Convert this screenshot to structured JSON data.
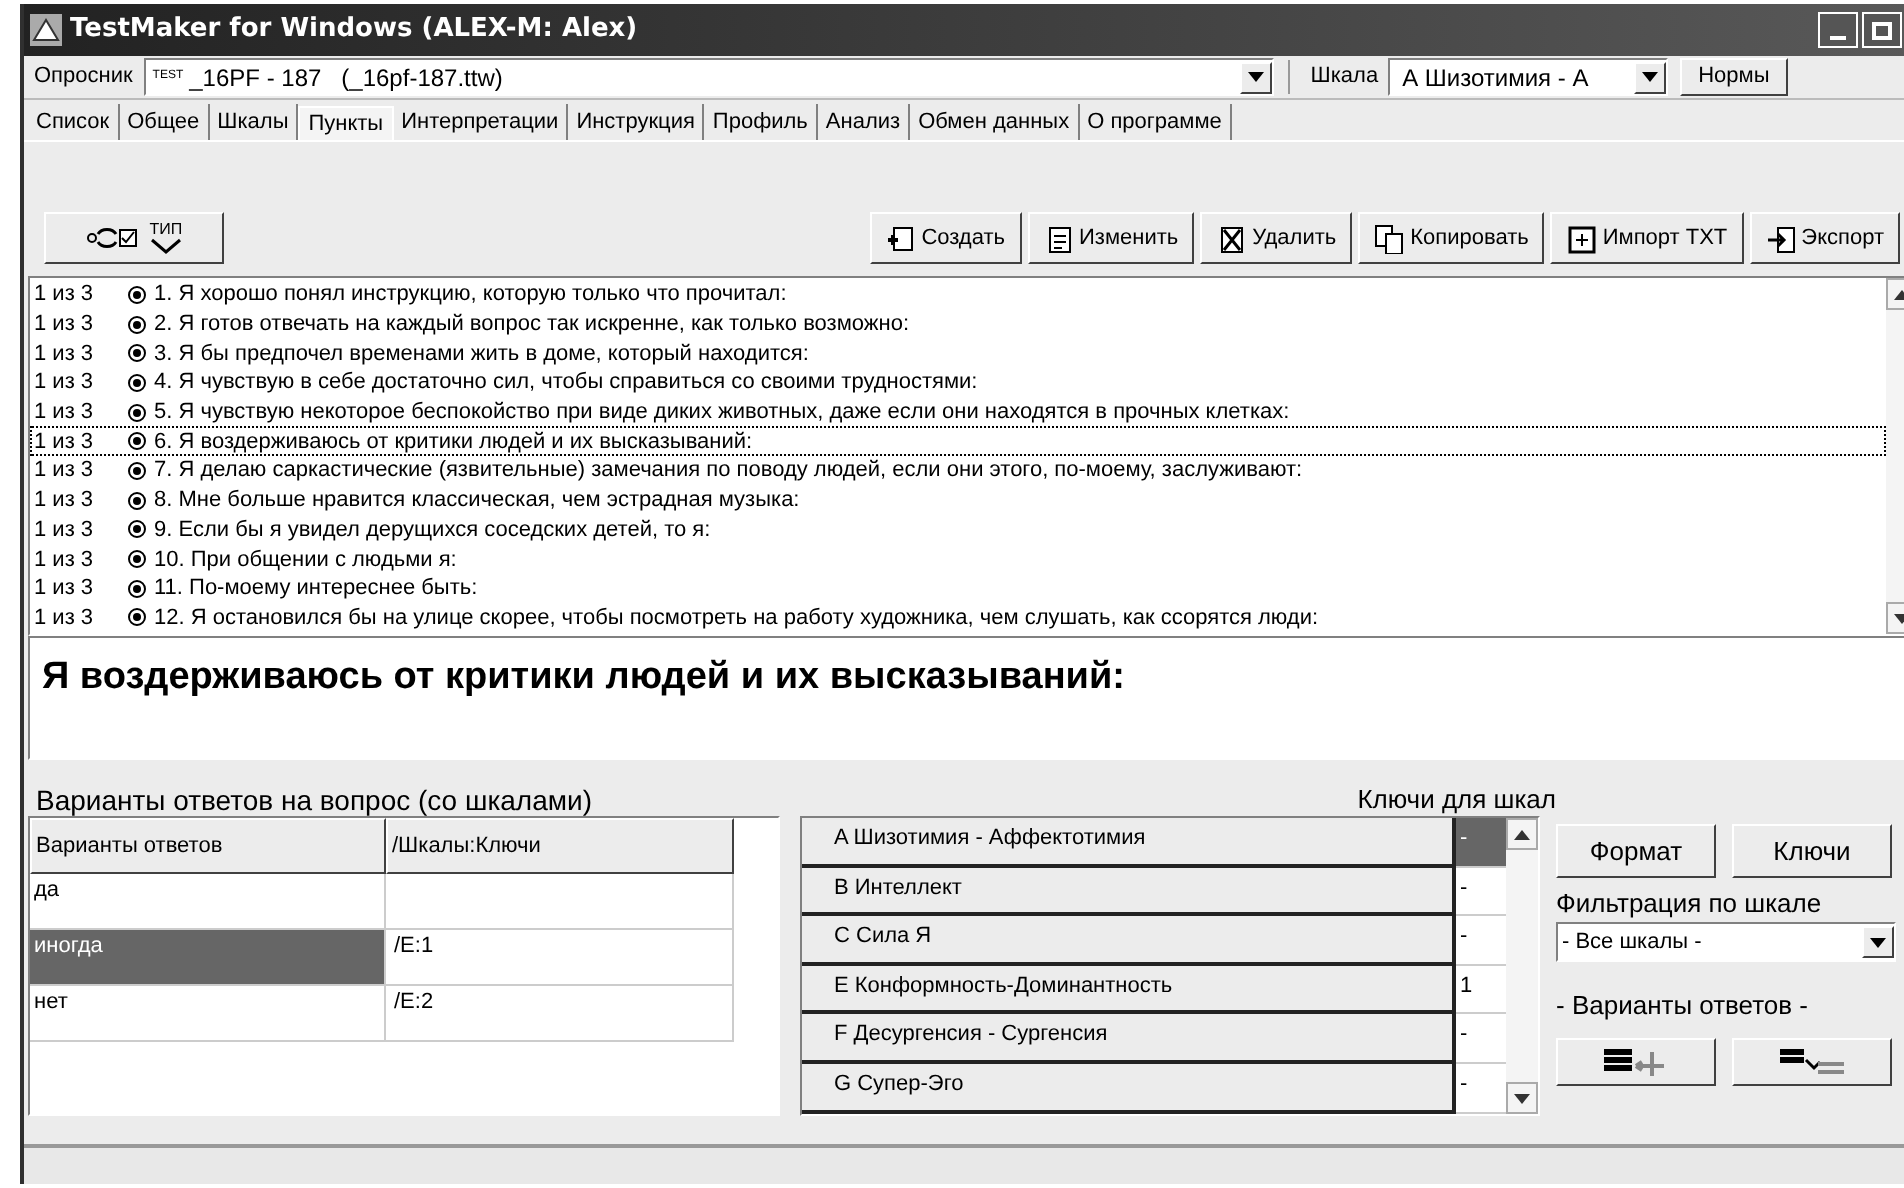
{
  "window": {
    "title": "TestMaker for Windows (ALEX-M: Alex)"
  },
  "header": {
    "questionnaire_label": "Опросник",
    "questionnaire_tag": "TEST",
    "questionnaire_value": "_16PF - 187   (_16pf-187.ttw)",
    "scale_label": "Шкала",
    "scale_value": "А Шизотимия - А",
    "norms_button": "Нормы"
  },
  "tabs": [
    {
      "label": "Список",
      "selected": false
    },
    {
      "label": "Общее",
      "selected": false
    },
    {
      "label": "Шкалы",
      "selected": false
    },
    {
      "label": "Пункты",
      "selected": true
    },
    {
      "label": "Интерпретации",
      "selected": false
    },
    {
      "label": "Инструкция",
      "selected": false
    },
    {
      "label": "Профиль",
      "selected": false
    },
    {
      "label": "Анализ",
      "selected": false
    },
    {
      "label": "Обмен данных",
      "selected": false
    },
    {
      "label": "О программе",
      "selected": false
    }
  ],
  "toolbar": {
    "type_label": "ТИП",
    "buttons": [
      {
        "label": "Создать",
        "kind": "create"
      },
      {
        "label": "Изменить",
        "kind": "edit"
      },
      {
        "label": "Удалить",
        "kind": "delete"
      },
      {
        "label": "Копировать",
        "kind": "copy"
      },
      {
        "label": "Импорт TXT",
        "kind": "import"
      },
      {
        "label": "Экспорт",
        "kind": "export"
      }
    ]
  },
  "items": [
    {
      "count": "1 из 3",
      "text": "1. Я хорошо понял инструкцию, которую только что прочитал:",
      "selected": false
    },
    {
      "count": "1 из 3",
      "text": "2. Я готов отвечать на каждый вопрос так искренне, как только возможно:",
      "selected": false
    },
    {
      "count": "1 из 3",
      "text": "3. Я бы предпочел временами жить в доме, который находится:",
      "selected": false
    },
    {
      "count": "1 из 3",
      "text": "4. Я чувствую в себе достаточно сил, чтобы справиться со своими трудностями:",
      "selected": false
    },
    {
      "count": "1 из 3",
      "text": "5. Я чувствую некоторое беспокойство при виде диких животных, даже если они находятся в прочных клетках:",
      "selected": false
    },
    {
      "count": "1 из 3",
      "text": "6. Я воздерживаюсь от критики людей и их высказываний:",
      "selected": true
    },
    {
      "count": "1 из 3",
      "text": "7. Я делаю саркастические (язвительные) замечания по поводу людей, если они этого, по-моему, заслуживают:",
      "selected": false
    },
    {
      "count": "1 из 3",
      "text": "8. Мне больше нравится классическая, чем эстрадная музыка:",
      "selected": false
    },
    {
      "count": "1 из 3",
      "text": "9. Если бы я увидел дерущихся соседских детей, то я:",
      "selected": false
    },
    {
      "count": "1 из 3",
      "text": "10. При общении с людьми я:",
      "selected": false
    },
    {
      "count": "1 из 3",
      "text": "11. По-моему интереснее быть:",
      "selected": false
    },
    {
      "count": "1 из 3",
      "text": "12. Я остановился бы на улице скорее, чтобы посмотреть на работу художника, чем слушать, как ссорятся люди:",
      "selected": false
    }
  ],
  "question_text": "Я воздерживаюсь от критики людей и их высказываний:",
  "answers": {
    "title": "Варианты ответов на вопрос (со шкалами)",
    "columns": [
      "Варианты ответов",
      "/Шкалы:Ключи"
    ],
    "rows": [
      {
        "answer": "да",
        "keys": "",
        "selected": false
      },
      {
        "answer": "иногда",
        "keys": "/E:1",
        "selected": true
      },
      {
        "answer": "нет",
        "keys": "/E:2",
        "selected": false
      }
    ]
  },
  "keys": {
    "title": "Ключи для шкал",
    "rows": [
      {
        "scale": "A Шизотимия - Аффектотимия",
        "value": "-",
        "selected": true
      },
      {
        "scale": "B Интеллект",
        "value": "-",
        "selected": false
      },
      {
        "scale": "C Сила Я",
        "value": "-",
        "selected": false
      },
      {
        "scale": "E Конформность-Доминантность",
        "value": "1",
        "selected": false
      },
      {
        "scale": "F Десургенсия - Сургенсия",
        "value": "-",
        "selected": false
      },
      {
        "scale": "G Супер-Эго",
        "value": "-",
        "selected": false
      }
    ]
  },
  "side": {
    "format_button": "Формат",
    "keys_button": "Ключи",
    "filter_label": "Фильтрация по шкале",
    "filter_value": "- Все шкалы -",
    "answers_label": "- Варианты ответов -"
  }
}
